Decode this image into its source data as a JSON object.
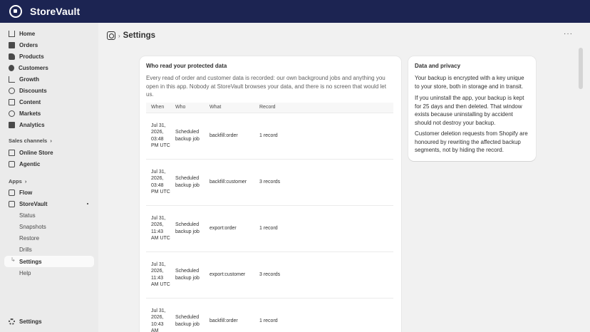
{
  "app": {
    "brand": "StoreVault"
  },
  "sidebar": {
    "items": [
      {
        "label": "Home",
        "icon": "home-icon"
      },
      {
        "label": "Orders",
        "icon": "orders-icon"
      },
      {
        "label": "Products",
        "icon": "tag-icon"
      },
      {
        "label": "Customers",
        "icon": "person-icon"
      },
      {
        "label": "Growth",
        "icon": "growth-icon"
      },
      {
        "label": "Discounts",
        "icon": "discount-icon"
      },
      {
        "label": "Content",
        "icon": "content-icon"
      },
      {
        "label": "Markets",
        "icon": "globe-icon"
      },
      {
        "label": "Analytics",
        "icon": "analytics-icon"
      }
    ],
    "sales_channels_label": "Sales channels",
    "channels": [
      {
        "label": "Online Store",
        "icon": "store-icon"
      },
      {
        "label": "Agentic",
        "icon": "agentic-icon"
      }
    ],
    "apps_label": "Apps",
    "apps": [
      {
        "label": "Flow",
        "icon": "flow-icon"
      },
      {
        "label": "StoreVault",
        "icon": "storevault-icon"
      }
    ],
    "app_subitems": [
      {
        "label": "Status"
      },
      {
        "label": "Snapshots"
      },
      {
        "label": "Restore"
      },
      {
        "label": "Drills"
      },
      {
        "label": "Settings"
      },
      {
        "label": "Help"
      }
    ],
    "footer_settings": "Settings"
  },
  "page": {
    "title": "Settings",
    "more_label": "···"
  },
  "audit_card": {
    "title": "Who read your protected data",
    "description": "Every read of order and customer data is recorded: our own background jobs and anything you open in this app. Nobody at StoreVault browses your data, and there is no screen that would let us.",
    "columns": [
      "When",
      "Who",
      "What",
      "Record"
    ],
    "rows": [
      {
        "when": "Jul 31, 2026, 03:48 PM UTC",
        "who": "Scheduled backup job",
        "what": "backfill:order",
        "record": "1 record"
      },
      {
        "when": "Jul 31, 2026, 03:48 PM UTC",
        "who": "Scheduled backup job",
        "what": "backfill:customer",
        "record": "3 records"
      },
      {
        "when": "Jul 31, 2026, 11:43 AM UTC",
        "who": "Scheduled backup job",
        "what": "export:order",
        "record": "1 record"
      },
      {
        "when": "Jul 31, 2026, 11:43 AM UTC",
        "who": "Scheduled backup job",
        "what": "export:customer",
        "record": "3 records"
      },
      {
        "when": "Jul 31, 2026, 10:43 AM",
        "who": "Scheduled backup job",
        "what": "backfill:order",
        "record": "1 record"
      }
    ]
  },
  "privacy_card": {
    "title": "Data and privacy",
    "p1": "Your backup is encrypted with a key unique to your store, both in storage and in transit.",
    "p2": "If you uninstall the app, your backup is kept for 25 days and then deleted. That window exists because uninstalling by accident should not destroy your backup.",
    "p3": "Customer deletion requests from Shopify are honoured by rewriting the affected backup segments, not by hiding the record."
  }
}
